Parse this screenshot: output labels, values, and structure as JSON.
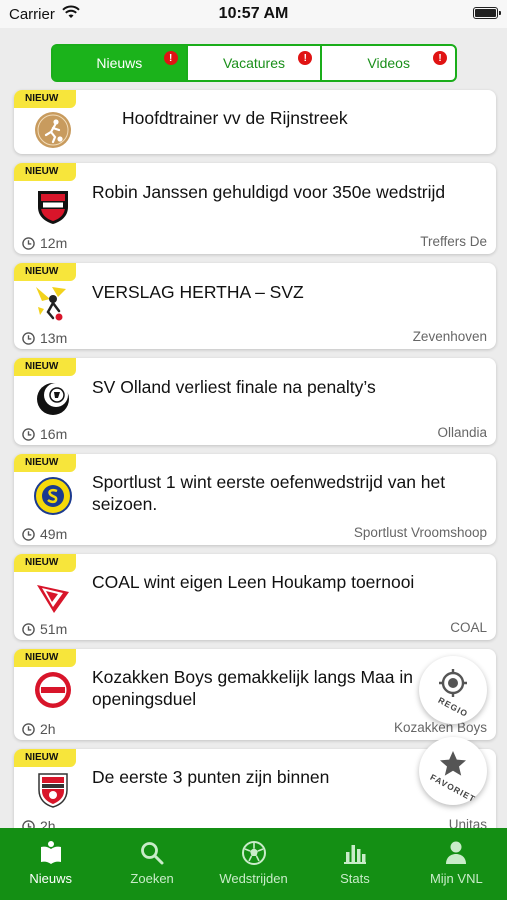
{
  "status_bar": {
    "carrier": "Carrier",
    "time": "10:57 AM"
  },
  "tabs": [
    {
      "label": "Nieuws",
      "badge": "!",
      "active": true
    },
    {
      "label": "Vacatures",
      "badge": "!",
      "active": false
    },
    {
      "label": "Videos",
      "badge": "!",
      "active": false
    }
  ],
  "items": [
    {
      "badge": "NIEUW",
      "title": "Hoofdtrainer vv de Rijnstreek",
      "time": "",
      "source": ""
    },
    {
      "badge": "NIEUW",
      "title": "Robin Janssen gehuldigd voor 350e wedstrijd",
      "time": "12m",
      "source": "Treffers De"
    },
    {
      "badge": "NIEUW",
      "title": "VERSLAG HERTHA – SVZ",
      "time": "13m",
      "source": "Zevenhoven"
    },
    {
      "badge": "NIEUW",
      "title": "SV Olland verliest finale na penalty’s",
      "time": "16m",
      "source": "Ollandia"
    },
    {
      "badge": "NIEUW",
      "title": "Sportlust 1 wint eerste oefenwedstrijd van het seizoen.",
      "time": "49m",
      "source": "Sportlust Vroomshoop"
    },
    {
      "badge": "NIEUW",
      "title": "COAL wint eigen Leen Houkamp toernooi",
      "time": "51m",
      "source": "COAL"
    },
    {
      "badge": "NIEUW",
      "title": "Kozakken Boys gemakkelijk langs Maa in openingsduel",
      "time": "2h",
      "source": "Kozakken Boys"
    },
    {
      "badge": "NIEUW",
      "title": "De eerste 3 punten zijn binnen",
      "time": "2h",
      "source": "Unitas"
    }
  ],
  "fabs": {
    "regio": "REGIO",
    "favoriet": "FAVORIET"
  },
  "nav": [
    {
      "label": "Nieuws",
      "icon": "news-icon",
      "active": true
    },
    {
      "label": "Zoeken",
      "icon": "search-icon",
      "active": false
    },
    {
      "label": "Wedstrijden",
      "icon": "soccer-ball-icon",
      "active": false
    },
    {
      "label": "Stats",
      "icon": "stats-icon",
      "active": false
    },
    {
      "label": "Mijn VNL",
      "icon": "person-icon",
      "active": false
    }
  ],
  "colors": {
    "brand_green": "#148f14",
    "tab_green": "#1bb31b",
    "badge_yellow": "#f7e53b",
    "alert_red": "#e01313"
  }
}
